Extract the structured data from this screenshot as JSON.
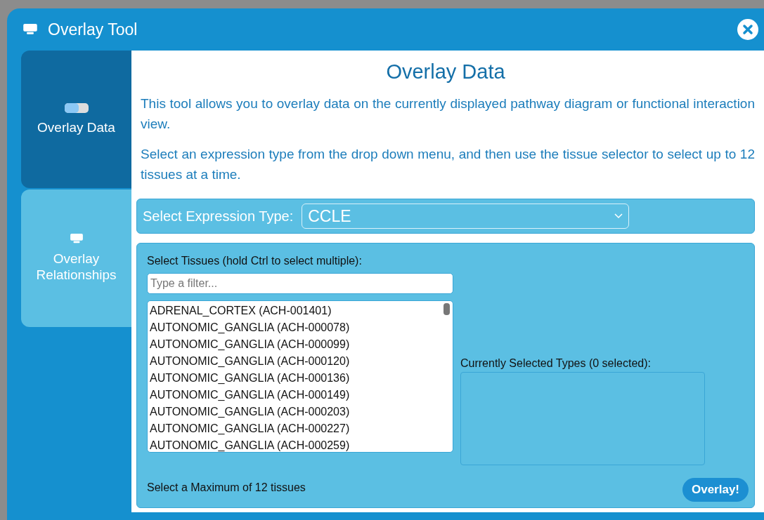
{
  "window": {
    "title": "Overlay Tool"
  },
  "tabs": [
    {
      "label": "Overlay Data",
      "selected": true
    },
    {
      "label": "Overlay Relationships",
      "selected": false
    }
  ],
  "content": {
    "heading": "Overlay Data",
    "paragraphs": [
      "This tool allows you to overlay data on the currently displayed pathway diagram or functional interaction view.",
      "Select an expression type from the drop down menu, and then use the tissue selector to select up to 12 tissues at a time."
    ],
    "expression_type": {
      "label": "Select Expression Type:",
      "value": "CCLE"
    },
    "tissues": {
      "label": "Select Tissues (hold Ctrl to select multiple):",
      "filter": {
        "placeholder": "Type a filter..."
      },
      "items": [
        "ADRENAL_CORTEX (ACH-001401)",
        "AUTONOMIC_GANGLIA (ACH-000078)",
        "AUTONOMIC_GANGLIA (ACH-000099)",
        "AUTONOMIC_GANGLIA (ACH-000120)",
        "AUTONOMIC_GANGLIA (ACH-000136)",
        "AUTONOMIC_GANGLIA (ACH-000149)",
        "AUTONOMIC_GANGLIA (ACH-000203)",
        "AUTONOMIC_GANGLIA (ACH-000227)",
        "AUTONOMIC_GANGLIA (ACH-000259)"
      ],
      "selected_label": "Currently Selected Types (0 selected):",
      "note": "Select a Maximum of 12 tissues",
      "button": "Overlay!"
    }
  }
}
